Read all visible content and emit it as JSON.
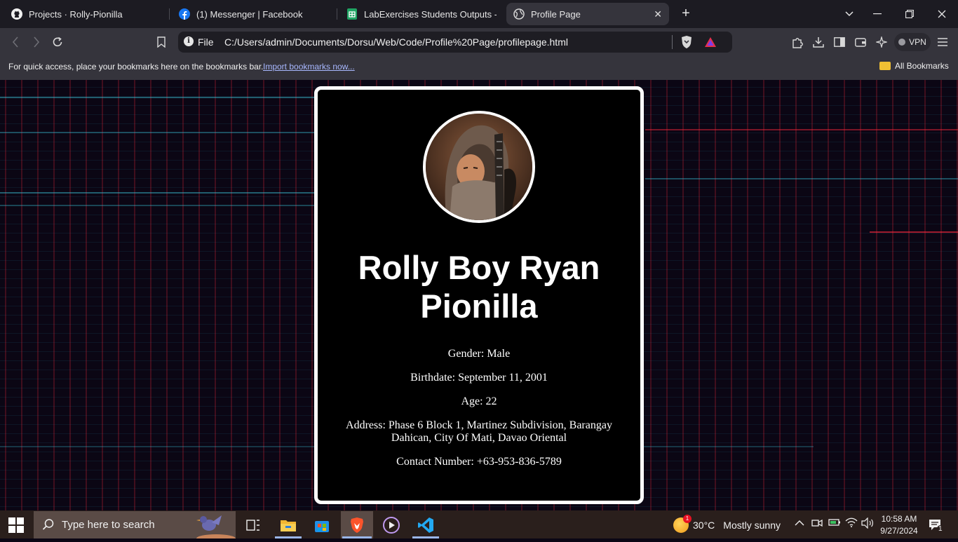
{
  "browser": {
    "tabs": [
      {
        "label": "Projects · Rolly-Pionilla",
        "icon": "github-icon"
      },
      {
        "label": "(1) Messenger | Facebook",
        "icon": "facebook-icon"
      },
      {
        "label": "LabExercises Students Outputs - Go",
        "icon": "google-sheets-icon"
      },
      {
        "label": "Profile Page",
        "icon": "globe-icon",
        "active": true
      }
    ],
    "address": {
      "scheme_label": "File",
      "url": "C:/Users/admin/Documents/Dorsu/Web/Code/Profile%20Page/profilepage.html"
    },
    "vpn_label": "VPN",
    "bookmarks_bar": {
      "prompt": "For quick access, place your bookmarks here on the bookmarks bar.",
      "import_link": "Import bookmarks now...",
      "all_bookmarks": "All Bookmarks"
    }
  },
  "profile": {
    "name": "Rolly Boy Ryan Pionilla",
    "gender": "Gender: Male",
    "birthdate": "Birthdate: September 11, 2001",
    "age": "Age: 22",
    "address": "Address: Phase 6 Block 1, Martinez Subdivision, Barangay Dahican, City Of Mati, Davao Oriental",
    "contact": "Contact Number: +63-953-836-5789"
  },
  "taskbar": {
    "search_placeholder": "Type here to search",
    "weather": {
      "temp": "30°C",
      "condition": "Mostly sunny",
      "badge": "1"
    },
    "time": "10:58 AM",
    "date": "9/27/2024",
    "notifications": "1"
  },
  "colors": {
    "page_bg": "#0b0614",
    "card_bg": "#000000",
    "card_border": "#ffffff",
    "tab_strip": "#1c1b22",
    "toolbar": "#35343c",
    "taskbar": "#2a1f1c",
    "brave_orange": "#fb542b",
    "vscode_blue": "#23a9f2"
  }
}
